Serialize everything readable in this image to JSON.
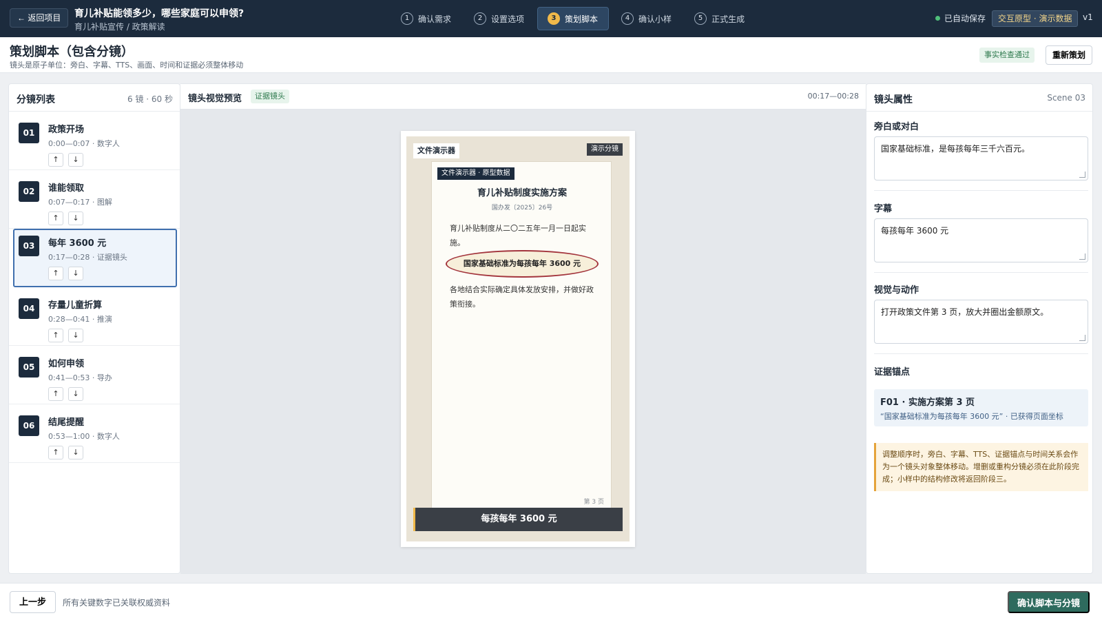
{
  "topbar": {
    "back_label": "← 返回项目",
    "title": "育儿补贴能领多少，哪些家庭可以申领?",
    "subtitle": "育儿补贴宣传 / 政策解读",
    "steps": [
      {
        "num": "1",
        "label": "确认需求"
      },
      {
        "num": "2",
        "label": "设置选项"
      },
      {
        "num": "3",
        "label": "策划脚本"
      },
      {
        "num": "4",
        "label": "确认小样"
      },
      {
        "num": "5",
        "label": "正式生成"
      }
    ],
    "autosave": "已自动保存",
    "demo_badge": "交互原型 · 演示数据",
    "version": "v1"
  },
  "page": {
    "title": "策划脚本（包含分镜）",
    "desc": "镜头是原子单位：旁白、字幕、TTS、画面、时间和证据必须整体移动",
    "check_badge": "事实检查通过",
    "replan_label": "重新策划"
  },
  "shots_panel": {
    "title": "分镜列表",
    "meta": "6 镜 · 60 秒",
    "up_label": "↑",
    "down_label": "↓",
    "items": [
      {
        "num": "01",
        "title": "政策开场",
        "meta": "0:00—0:07 · 数字人"
      },
      {
        "num": "02",
        "title": "谁能领取",
        "meta": "0:07—0:17 · 图解"
      },
      {
        "num": "03",
        "title": "每年 3600 元",
        "meta": "0:17—0:28 · 证据镜头"
      },
      {
        "num": "04",
        "title": "存量儿童折算",
        "meta": "0:28—0:41 · 推演"
      },
      {
        "num": "05",
        "title": "如何申领",
        "meta": "0:41—0:53 · 导办"
      },
      {
        "num": "06",
        "title": "结尾提醒",
        "meta": "0:53—1:00 · 数字人"
      }
    ]
  },
  "preview": {
    "title": "镜头视觉预览",
    "badge": "证据镜头",
    "timecode": "00:17—00:28",
    "stage_label": "文件演示器",
    "stage_tag": "演示分镜",
    "doc_badge": "文件演示器 · 原型数据",
    "doc_title": "育儿补贴制度实施方案",
    "doc_number": "国办发〔2025〕26号",
    "doc_para1": "育儿补贴制度从二〇二五年一月一日起实施。",
    "doc_highlight": "国家基础标准为每孩每年 3600 元",
    "doc_para2": "各地结合实际确定具体发放安排，并做好政策衔接。",
    "doc_page": "第 3 页",
    "subtitle": "每孩每年 3600 元"
  },
  "props": {
    "title": "镜头属性",
    "scene": "Scene 03",
    "narration_label": "旁白或对白",
    "narration_value": "国家基础标准，是每孩每年三千六百元。",
    "subtitle_label": "字幕",
    "subtitle_value": "每孩每年 3600 元",
    "visual_label": "视觉与动作",
    "visual_value": "打开政策文件第 3 页，放大并圈出金额原文。",
    "evidence_label": "证据锚点",
    "evidence_title": "F01 · 实施方案第 3 页",
    "evidence_quote": "“国家基础标准为每孩每年 3600 元” · 已获得页面坐标",
    "note": "调整顺序时，旁白、字幕、TTS、证据锚点与时间关系会作为一个镜头对象整体移动。增删或重构分镜必须在此阶段完成；小样中的结构修改将返回阶段三。"
  },
  "bottom": {
    "prev_label": "上一步",
    "note": "所有关键数字已关联权威资料",
    "confirm_label": "确认脚本与分镜"
  }
}
